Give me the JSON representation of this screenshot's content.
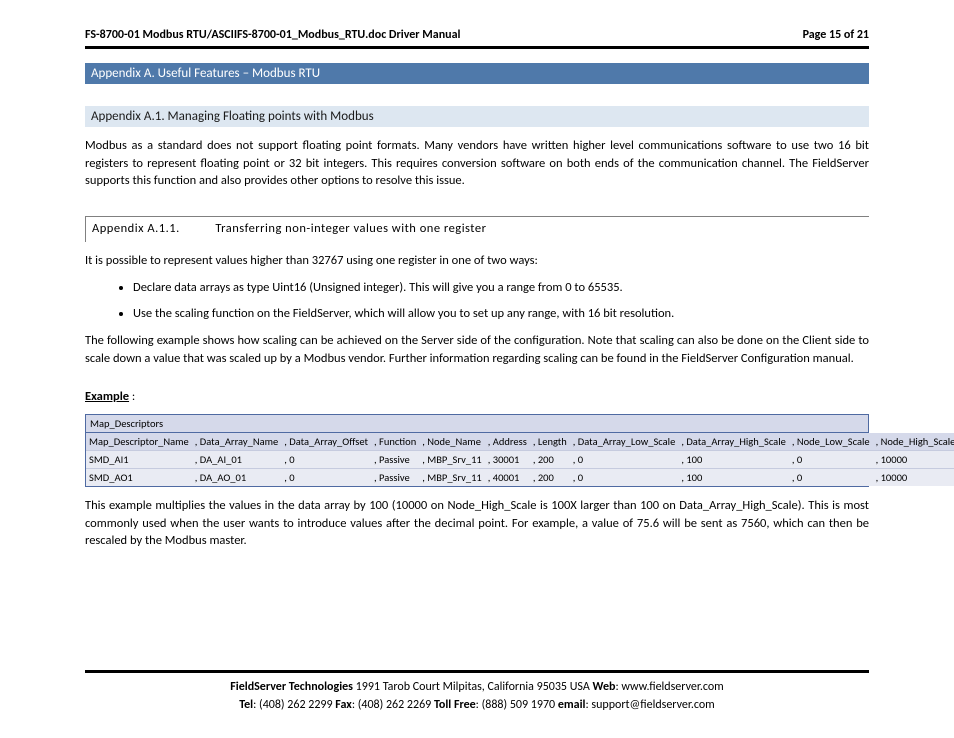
{
  "header": {
    "doc_title": "FS-8700-01 Modbus RTU/ASCIIFS-8700-01_Modbus_RTU.doc Driver Manual",
    "page_label": "Page 15 of 21"
  },
  "section": {
    "title": "Appendix A. Useful Features – Modbus RTU"
  },
  "subsection": {
    "title": "Appendix A.1. Managing Floating points with Modbus",
    "para": "Modbus as a standard does not support floating point formats.  Many vendors have written higher level communications software to use two 16 bit registers to represent floating point or 32 bit integers.  This requires conversion software on both ends of the communication channel.  The FieldServer supports this function and also provides other options to resolve this issue."
  },
  "subsub": {
    "num": "Appendix A.1.1.",
    "title": "Transferring non-integer values with one register",
    "intro": "It is possible to represent values higher than 32767 using one register in one of two ways:",
    "bullets": [
      "Declare data arrays as type Uint16 (Unsigned integer). This will give you a range from 0 to 65535.",
      "Use the scaling function on the FieldServer, which will allow you to set up any range, with 16 bit resolution."
    ],
    "para2": "The following example shows how scaling can be achieved on the Server side of the configuration.  Note that scaling can also be done on the Client side to scale down a value that was scaled up by a Modbus vendor.  Further information regarding scaling can be found in the FieldServer Configuration manual."
  },
  "example": {
    "label_strong": "Example",
    "label_tail": " :",
    "table_title": "Map_Descriptors",
    "columns": [
      "Map_Descriptor_Name",
      ", Data_Array_Name",
      ", Data_Array_Offset",
      ", Function",
      ", Node_Name",
      ", Address",
      ", Length",
      ", Data_Array_Low_Scale",
      ", Data_Array_High_Scale",
      ", Node_Low_Scale",
      ", Node_High_Scale"
    ],
    "rows": [
      [
        "SMD_AI1",
        ", DA_AI_01",
        ", 0",
        ", Passive",
        ", MBP_Srv_11",
        ", 30001",
        ", 200",
        ", 0",
        ", 100",
        ", 0",
        ", 10000"
      ],
      [
        "SMD_AO1",
        ", DA_AO_01",
        ", 0",
        ", Passive",
        ", MBP_Srv_11",
        ", 40001",
        ", 200",
        ", 0",
        ", 100",
        ", 0",
        ", 10000"
      ]
    ],
    "after": "This example multiplies the values in the data array by 100 (10000 on Node_High_Scale is 100X larger than 100 on Data_Array_High_Scale).  This is most commonly used when the user wants to introduce values after the decimal point.  For example, a value of 75.6 will be sent as 7560, which can then be rescaled by the Modbus master."
  },
  "footer": {
    "company": "FieldServer Technologies",
    "addr": " 1991 Tarob Court Milpitas, California 95035 USA  ",
    "web_label": "Web",
    "web_val": ": www.fieldserver.com",
    "tel_label": "Tel",
    "tel_val": ": (408) 262 2299  ",
    "fax_label": "Fax",
    "fax_val": ": (408) 262 2269  ",
    "toll_label": "Toll Free",
    "toll_val": ": (888) 509 1970  ",
    "email_label": "email",
    "email_val": ": support@fieldserver.com"
  }
}
